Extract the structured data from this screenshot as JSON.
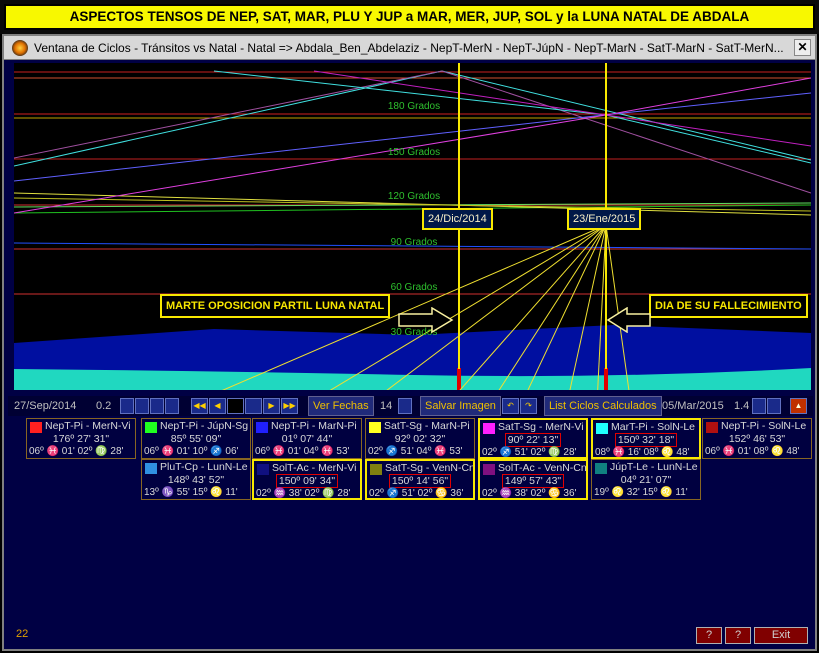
{
  "banner": {
    "title": "ASPECTOS TENSOS DE NEP, SAT, MAR, PLU Y JUP a MAR, MER, JUP, SOL y la LUNA NATAL DE ABDALA"
  },
  "window": {
    "title": "Ventana de Ciclos - Tránsitos vs Natal - Natal => Abdala_Ben_Abdelaziz - NepT-MerN - NepT-JúpN - NepT-MarN - SatT-MarN - SatT-MerN..."
  },
  "chart": {
    "degree_labels": [
      "180 Grados",
      "150 Grados",
      "120 Grados",
      "90 Grados",
      "60 Grados",
      "30 Grados"
    ],
    "date_markers": [
      "24/Dic/2014",
      "23/Ene/2015"
    ],
    "annotations": {
      "left": "MARTE OPOSICION PARTIL LUNA NATAL",
      "right": "DIA DE SU FALLECIMIENTO"
    }
  },
  "controls": {
    "start_date": "27/Sep/2014",
    "step": "0.2",
    "ver_fechas": "Ver Fechas",
    "ver_count": "14",
    "salvar": "Salvar Imagen",
    "list": "List Ciclos Calculados",
    "end_date": "05/Mar/2015",
    "zoom": "1.4"
  },
  "aspects": [
    {
      "name": "NepT-Pi - MerN-Vi",
      "angle": "176º 27' 31\"",
      "positions": "06º ♓ 01'  02º ♍ 28'",
      "color": "#ff2020",
      "highlight": false
    },
    {
      "name": "NepT-Pi - JúpN-Sg",
      "angle": "85º 55' 09\"",
      "positions": "06º ♓ 01'  10º ♐ 06'",
      "color": "#20ff20",
      "highlight": false
    },
    {
      "name": "NepT-Pi - MarN-Pi",
      "angle": "01º 07' 44\"",
      "positions": "06º ♓ 01'  04º ♓ 53'",
      "color": "#2020ff",
      "highlight": false
    },
    {
      "name": "SatT-Sg - MarN-Pi",
      "angle": "92º 02' 32\"",
      "positions": "02º ♐ 51'  04º ♓ 53'",
      "color": "#ffff20",
      "highlight": false
    },
    {
      "name": "SatT-Sg - MerN-Vi",
      "angle": "90º 22' 13\"",
      "positions": "02º ♐ 51'  02º ♍ 28'",
      "color": "#ff20ff",
      "highlight": true
    },
    {
      "name": "MarT-Pi - SolN-Le",
      "angle": "150º 32' 18\"",
      "positions": "08º ♓ 16'  08º ♌ 48'",
      "color": "#20ffff",
      "highlight": true
    },
    {
      "name": "NepT-Pi - SolN-Le",
      "angle": "152º 46' 53\"",
      "positions": "06º ♓ 01'  08º ♌ 48'",
      "color": "#b01010",
      "highlight": false
    },
    {
      "name": "PluT-Cp - LunN-Le",
      "angle": "148º 43' 52\"",
      "positions": "13º ♑ 55'  15º ♌ 11'",
      "color": "#3090e0",
      "highlight": false
    },
    {
      "name": "SolT-Ac - MerN-Vi",
      "angle": "150º 09' 34\"",
      "positions": "02º ♒ 38'  02º ♍ 28'",
      "color": "#101080",
      "highlight": true
    },
    {
      "name": "SatT-Sg - VenN-Cn",
      "angle": "150º 14' 56\"",
      "positions": "02º ♐ 51'  02º ♋ 36'",
      "color": "#808010",
      "highlight": true
    },
    {
      "name": "SolT-Ac - VenN-Cn",
      "angle": "149º 57' 43\"",
      "positions": "02º ♒ 38'  02º ♋ 36'",
      "color": "#801080",
      "highlight": true
    },
    {
      "name": "JúpT-Le - LunN-Le",
      "angle": "04º 21' 07\"",
      "positions": "19º ♌ 32'  15º ♌ 11'",
      "color": "#108080",
      "highlight": false
    }
  ],
  "status": {
    "count": "22",
    "q1": "?",
    "q2": "?",
    "exit": "Exit"
  }
}
